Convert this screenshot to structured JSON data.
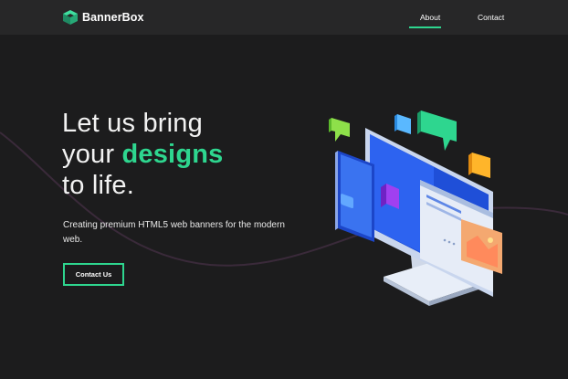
{
  "header": {
    "logo_text": "BannerBox",
    "logo_icon": "cube-logo-icon",
    "nav": [
      {
        "label": "About",
        "active": true
      },
      {
        "label": "Contact",
        "active": false
      }
    ]
  },
  "hero": {
    "title_line1": "Let us bring",
    "title_line2_prefix": "your ",
    "title_line2_accent": "designs",
    "title_line3": "to life.",
    "subtitle": "Creating premium HTML5 web banners for the modern web.",
    "cta_label": "Contact Us"
  },
  "colors": {
    "accent": "#2ed68f",
    "background": "#1c1c1d",
    "header_bg": "#272728",
    "wave": "#3a2a3a"
  },
  "illustration": {
    "icon": "monitor-phone-illustration"
  }
}
